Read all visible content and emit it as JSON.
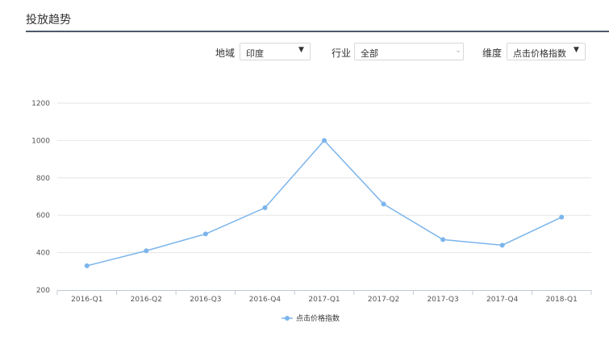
{
  "header": {
    "title": "投放趋势"
  },
  "filters": {
    "region_label": "地域",
    "region_value": "印度",
    "industry_label": "行业",
    "industry_value": "全部",
    "dimension_label": "维度",
    "dimension_value": "点击价格指数"
  },
  "chart_data": {
    "type": "line",
    "categories": [
      "2016-Q1",
      "2016-Q2",
      "2016-Q3",
      "2016-Q4",
      "2017-Q1",
      "2017-Q2",
      "2017-Q3",
      "2017-Q4",
      "2018-Q1"
    ],
    "series": [
      {
        "name": "点击价格指数",
        "values": [
          330,
          410,
          500,
          640,
          1000,
          660,
          470,
          440,
          590
        ],
        "color": "#7cb5ec"
      }
    ],
    "yticks": [
      200,
      400,
      600,
      800,
      1000,
      1200
    ],
    "ylim": [
      200,
      1200
    ],
    "title": "",
    "xlabel": "",
    "ylabel": "",
    "grid": true,
    "legend": "bottom-center",
    "colors": {
      "line": "#7cb5ec",
      "grid": "#e6e6e6",
      "axis": "#c0c8d4"
    }
  }
}
